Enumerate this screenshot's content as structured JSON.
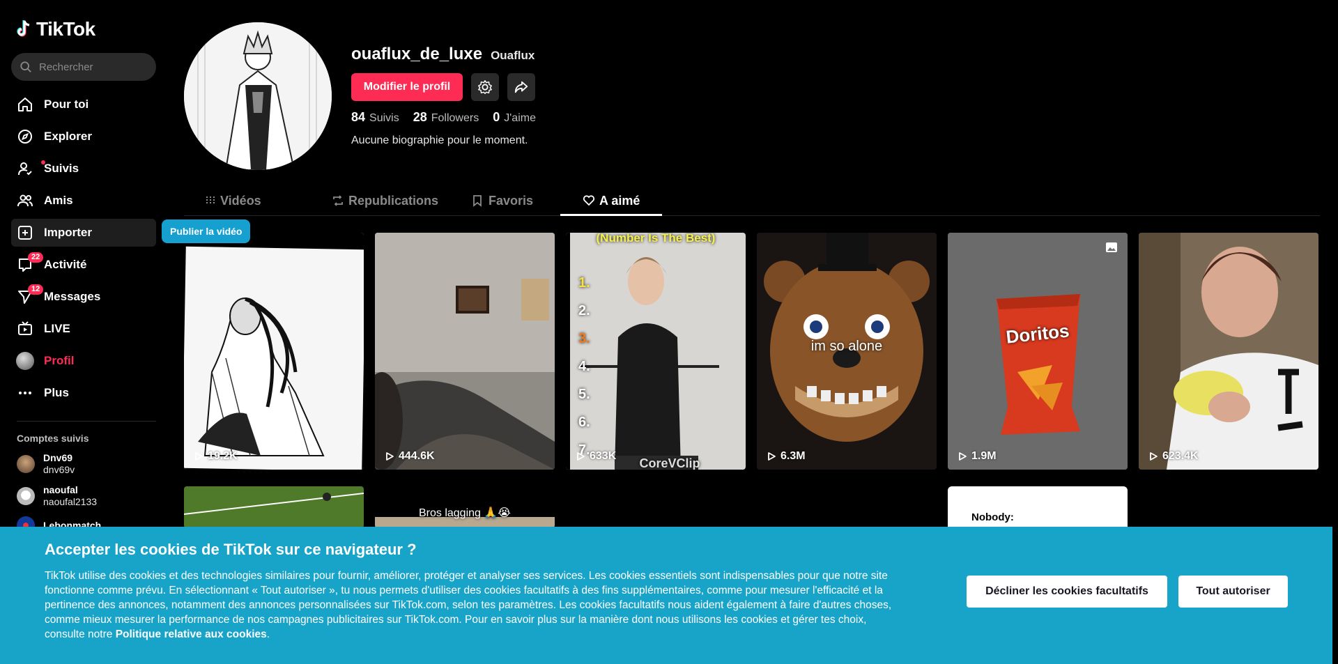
{
  "app": {
    "name": "TikTok"
  },
  "search": {
    "placeholder": "Rechercher"
  },
  "nav": {
    "items": [
      {
        "label": "Pour toi"
      },
      {
        "label": "Explorer"
      },
      {
        "label": "Suivis"
      },
      {
        "label": "Amis"
      },
      {
        "label": "Importer"
      },
      {
        "label": "Activité",
        "badge": "22"
      },
      {
        "label": "Messages",
        "badge": "12"
      },
      {
        "label": "LIVE"
      },
      {
        "label": "Profil"
      },
      {
        "label": "Plus"
      }
    ]
  },
  "following": {
    "title": "Comptes suivis",
    "accounts": [
      {
        "name": "Dnv69",
        "handle": "dnv69v"
      },
      {
        "name": "naoufal",
        "handle": "naoufal2133"
      },
      {
        "name": "Lebonmatch",
        "handle": ""
      }
    ]
  },
  "profile": {
    "username": "ouaflux_de_luxe",
    "nickname": "Ouaflux",
    "edit_label": "Modifier le profil",
    "following_count": "84",
    "following_label": "Suivis",
    "followers_count": "28",
    "followers_label": "Followers",
    "likes_count": "0",
    "likes_label": "J'aime",
    "bio": "Aucune biographie pour le moment."
  },
  "tabs": [
    {
      "label": "Vidéos"
    },
    {
      "label": "Republications"
    },
    {
      "label": "Favoris"
    },
    {
      "label": "A aimé",
      "active": true
    }
  ],
  "tooltip": {
    "label": "Publier la vidéo"
  },
  "videos": [
    {
      "views": "19.2K"
    },
    {
      "views": "444.6K"
    },
    {
      "views": "633K",
      "title_text": "(Number Is The Best)",
      "numbers": [
        "1.",
        "2.",
        "3.",
        "4.",
        "5.",
        "6.",
        "7."
      ],
      "watermark": "CoreVClip"
    },
    {
      "views": "6.3M",
      "caption": "im so alone"
    },
    {
      "views": "1.9M",
      "brand": "Doritos"
    },
    {
      "views": "623.4K"
    }
  ],
  "row2": [
    {
      "caption": ""
    },
    {
      "caption": "Bros lagging 🙏😭"
    },
    {
      "caption": "Nobody:"
    }
  ],
  "cookie": {
    "title": "Accepter les cookies de TikTok sur ce navigateur ?",
    "body": "TikTok utilise des cookies et des technologies similaires pour fournir, améliorer, protéger et analyser ses services. Les cookies essentiels sont indispensables pour que notre site fonctionne comme prévu. En sélectionnant « Tout autoriser », tu nous permets d'utiliser des cookies facultatifs à des fins supplémentaires, comme pour mesurer l'efficacité et la pertinence des annonces, notamment des annonces personnalisées sur TikTok.com, selon tes paramètres. Les cookies facultatifs nous aident également à faire d'autres choses, comme mieux mesurer la performance de nos campagnes publicitaires sur TikTok.com. Pour en savoir plus sur la manière dont nous utilisons les cookies et gérer tes choix, consulte notre ",
    "link": "Politique relative aux cookies",
    "body_end": ".",
    "decline_label": "Décliner les cookies facultatifs",
    "accept_label": "Tout autoriser"
  },
  "colors": {
    "accent": "#fe2c55",
    "cookie_bg": "#18a4c8",
    "tooltip_bg": "#16a0d0"
  }
}
